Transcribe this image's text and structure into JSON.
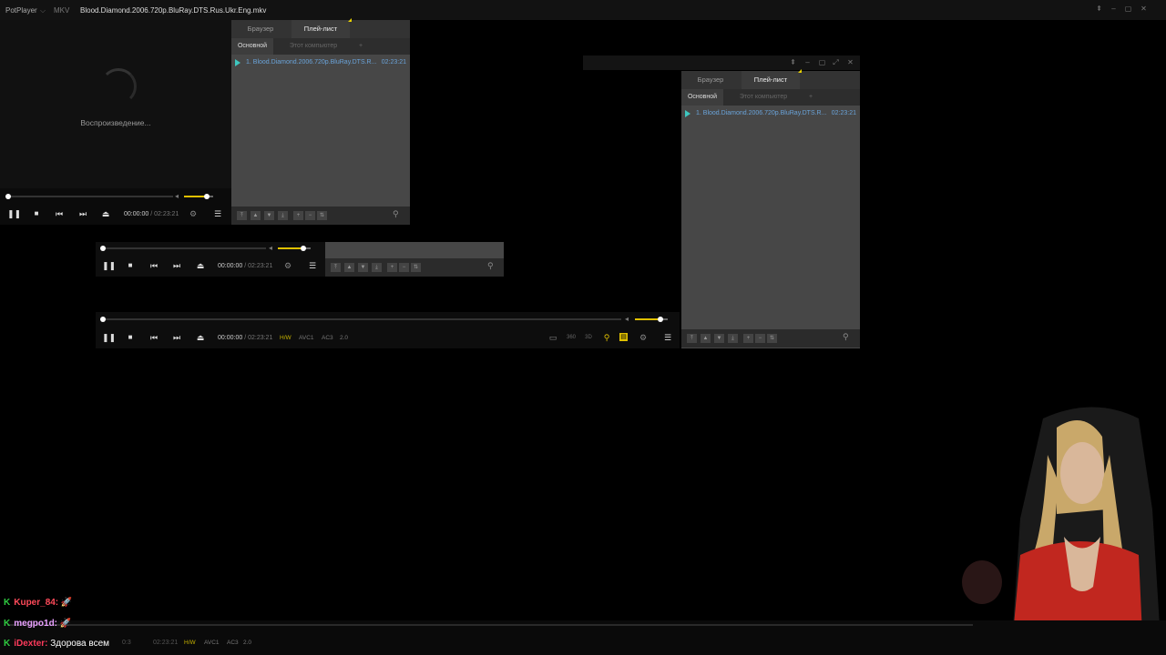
{
  "window": {
    "app_name": "PotPlayer",
    "app_chevron": "⌵",
    "format": "MKV",
    "title": "Blood.Diamond.2006.720p.BluRay.DTS.Rus.Ukr.Eng.mkv",
    "controls": [
      "pin-icon",
      "minimize-icon",
      "maximize-icon",
      "close-icon"
    ]
  },
  "player": {
    "status": "Воспроизведение...",
    "time_current": "00:00:00",
    "time_sep": " / ",
    "time_total": "02:23:21",
    "volume_level": 0.78,
    "progress": 0.0
  },
  "playlist": {
    "tabs": [
      "Браузер",
      "Плей-лист"
    ],
    "active_tab": "Плей-лист",
    "subtabs": [
      "Основной",
      "Этот компьютер",
      "+"
    ],
    "active_subtab": "Основной",
    "items": [
      {
        "name": "1. Blood.Diamond.2006.720p.BluRay.DTS.R...",
        "duration": "02:23:21"
      }
    ],
    "footer_buttons": [
      "⤒",
      "▲",
      "▼",
      "⤓",
      "+",
      "−",
      "⇅"
    ]
  },
  "info_tags": {
    "hw": "H/W",
    "video": "AVC1",
    "audio": "AC3",
    "channels": "2.0"
  },
  "bottom_bar": {
    "time_fragment": "02:23:21",
    "time_fragment_left": "0:3"
  },
  "chat": [
    {
      "user": "Kuper_84:",
      "message": "🚀",
      "badge": "K"
    },
    {
      "user": "megpo1d:",
      "message": "🚀",
      "badge": "K"
    },
    {
      "user": "iDexter:",
      "message": "Здорова всем",
      "badge": "K"
    }
  ],
  "colors": {
    "accent": "#e0c000",
    "playlist_text": "#6aa3d9",
    "play_marker": "#3ec7c0",
    "chat_badge": "#2ecc40"
  }
}
